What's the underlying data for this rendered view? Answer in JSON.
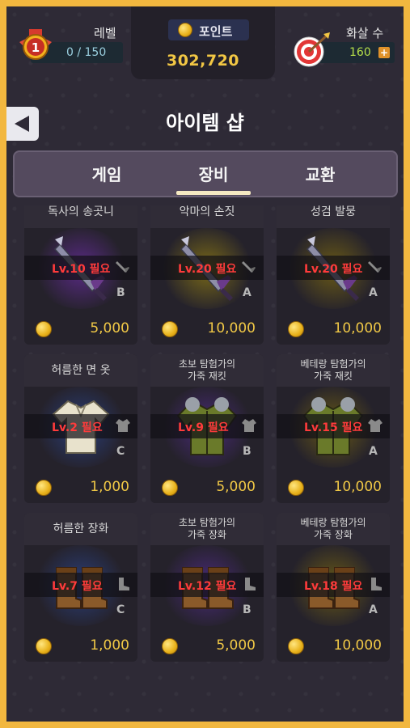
{
  "header": {
    "level_label": "레벨",
    "level_badge": "1",
    "level_value": "0 / 150",
    "points_label": "포인트",
    "points_value": "302,720",
    "arrows_label": "화살 수",
    "arrows_value": "160",
    "plus": "+"
  },
  "title": "아이템 샵",
  "tabs": [
    "게임",
    "장비",
    "교환"
  ],
  "active_tab": "장비",
  "colors": {
    "accent": "#f2b73f",
    "required": "#ff3b3b",
    "price": "#f0c846"
  },
  "items": [
    {
      "name": "독사의 송곳니",
      "req": "Lv.10 필요",
      "grade": "B",
      "price": "5,000",
      "category": "sword-icon",
      "art": "dagger",
      "glow": "#5a2a86"
    },
    {
      "name": "악마의 손짓",
      "req": "Lv.20 필요",
      "grade": "A",
      "price": "10,000",
      "category": "sword-icon",
      "art": "dagger",
      "glow": "#7a6a18"
    },
    {
      "name": "성검 발뭉",
      "req": "Lv.20 필요",
      "grade": "A",
      "price": "10,000",
      "category": "sword-icon",
      "art": "dagger",
      "glow": "#6a5a16"
    },
    {
      "name": "허름한 면 옷",
      "req": "Lv.2 필요",
      "grade": "C",
      "price": "1,000",
      "category": "armor-icon",
      "art": "shirt",
      "glow": "#2a3e7a"
    },
    {
      "name": "초보 탐험가의 가죽 재킷",
      "req": "Lv.9 필요",
      "grade": "B",
      "price": "5,000",
      "category": "armor-icon",
      "art": "jacket",
      "glow": "#4a2a7a"
    },
    {
      "name": "베테랑 탐험가의 가죽 재킷",
      "req": "Lv.15 필요",
      "grade": "A",
      "price": "10,000",
      "category": "armor-icon",
      "art": "jacket",
      "glow": "#6a5a16"
    },
    {
      "name": "허름한 장화",
      "req": "Lv.7 필요",
      "grade": "C",
      "price": "1,000",
      "category": "boot-icon",
      "art": "boots",
      "glow": "#2a3e7a"
    },
    {
      "name": "초보 탐험가의 가죽 장화",
      "req": "Lv.12 필요",
      "grade": "B",
      "price": "5,000",
      "category": "boot-icon",
      "art": "boots",
      "glow": "#4a2a7a"
    },
    {
      "name": "베테랑 탐험가의 가죽 장화",
      "req": "Lv.18 필요",
      "grade": "A",
      "price": "10,000",
      "category": "boot-icon",
      "art": "boots",
      "glow": "#6a5a16"
    }
  ]
}
